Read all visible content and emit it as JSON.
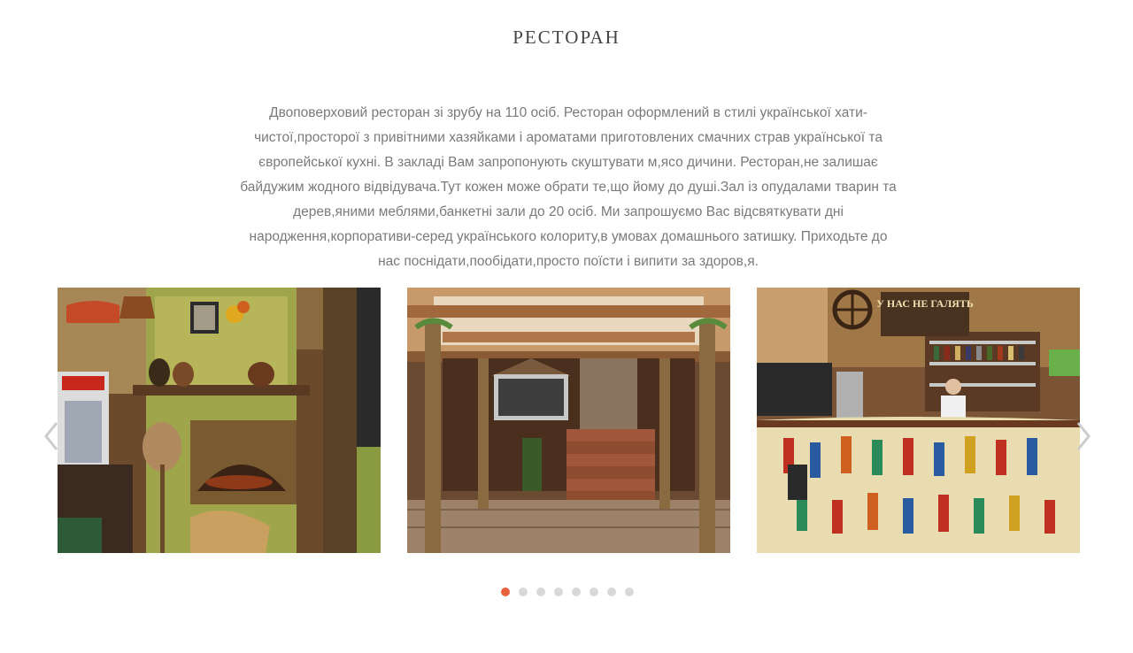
{
  "section": {
    "title": "РЕСТОРАН"
  },
  "description": {
    "lines": [
      "Двоповерховий ресторан зі зрубу на 110 осіб. Ресторан оформлений в стилі української хати-",
      "чистої,просторої з привітними хазяйками і ароматами приготовлених смачних страв української та",
      "європейської кухні. В закладі Вам запропонують скуштувати м,ясо дичини. Ресторан,не залишає",
      "байдужим жодного відвідувача.Тут кожен може обрати те,що йому до душі.Зал із опудалами тварин та",
      "дерев,яними меблями,банкетні зали до 20 осіб. Ми запрошуємо Вас відсвяткувати дні",
      "народження,корпоративи-серед українського колориту,в умовах домашнього затишку. Приходьте до",
      "нас поснідати,пообідати,просто поїсти і випити за здоров,я."
    ]
  },
  "carousel": {
    "slides": [
      {
        "icon": "photo-stove-interior"
      },
      {
        "icon": "photo-hall-staircase"
      },
      {
        "icon": "photo-bar-counter",
        "sign_text": "У НАС НЕ ГАЛЯТЬ"
      }
    ],
    "prev_icon": "chevron-left-icon",
    "next_icon": "chevron-right-icon",
    "dots_count": 8,
    "active_dot": 0,
    "colors": {
      "active_dot": "#e8613c",
      "inactive_dot": "#d8d8d8",
      "arrow": "#cccccc"
    }
  }
}
